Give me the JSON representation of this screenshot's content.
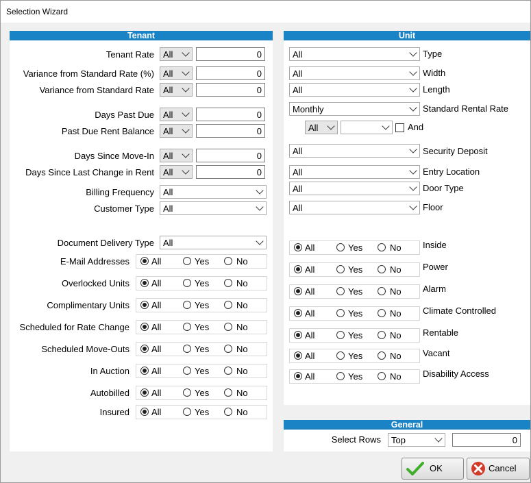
{
  "window": {
    "title": "Selection Wizard"
  },
  "tenant": {
    "header": "Tenant",
    "tenant_rate": {
      "label": "Tenant Rate",
      "op": "All",
      "value": "0"
    },
    "variance_pct": {
      "label": "Variance from Standard Rate (%)",
      "op": "All",
      "value": "0"
    },
    "variance_std": {
      "label": "Variance from Standard Rate",
      "op": "All",
      "value": "0"
    },
    "days_past_due": {
      "label": "Days Past Due",
      "op": "All",
      "value": "0"
    },
    "past_due_balance": {
      "label": "Past Due Rent Balance",
      "op": "All",
      "value": "0"
    },
    "days_since_move_in": {
      "label": "Days Since Move-In",
      "op": "All",
      "value": "0"
    },
    "days_since_change": {
      "label": "Days Since Last Change in Rent",
      "op": "All",
      "value": "0"
    },
    "billing_frequency": {
      "label": "Billing Frequency",
      "value": "All"
    },
    "customer_type": {
      "label": "Customer Type",
      "value": "All"
    },
    "document_delivery": {
      "label": "Document Delivery Type",
      "value": "All"
    },
    "radio_labels": {
      "all": "All",
      "yes": "Yes",
      "no": "No"
    },
    "radios": [
      {
        "label": "E-Mail Addresses",
        "selected": "All"
      },
      {
        "label": "Overlocked Units",
        "selected": "All"
      },
      {
        "label": "Complimentary Units",
        "selected": "All"
      },
      {
        "label": "Scheduled for Rate Change",
        "selected": "All"
      },
      {
        "label": "Scheduled Move-Outs",
        "selected": "All"
      },
      {
        "label": "In Auction",
        "selected": "All"
      },
      {
        "label": "Autobilled",
        "selected": "All"
      },
      {
        "label": "Insured",
        "selected": "All"
      }
    ]
  },
  "unit": {
    "header": "Unit",
    "type": {
      "label": "Type",
      "value": "All"
    },
    "width": {
      "label": "Width",
      "value": "All"
    },
    "length": {
      "label": "Length",
      "value": "All"
    },
    "standard_rental_rate": {
      "label": "Standard Rental Rate",
      "value": "Monthly"
    },
    "rate_op": {
      "value": "All"
    },
    "rate_value": {
      "value": ""
    },
    "and_label": "And",
    "and_checked": false,
    "security_deposit": {
      "label": "Security Deposit",
      "value": "All"
    },
    "entry_location": {
      "label": "Entry Location",
      "value": "All"
    },
    "door_type": {
      "label": "Door Type",
      "value": "All"
    },
    "floor": {
      "label": "Floor",
      "value": "All"
    },
    "radio_labels": {
      "all": "All",
      "yes": "Yes",
      "no": "No"
    },
    "radios": [
      {
        "label": "Inside",
        "selected": "All"
      },
      {
        "label": "Power",
        "selected": "All"
      },
      {
        "label": "Alarm",
        "selected": "All"
      },
      {
        "label": "Climate Controlled",
        "selected": "All"
      },
      {
        "label": "Rentable",
        "selected": "All"
      },
      {
        "label": "Vacant",
        "selected": "All"
      },
      {
        "label": "Disability Access",
        "selected": "All"
      }
    ]
  },
  "general": {
    "header": "General",
    "select_rows": {
      "label": "Select Rows",
      "mode": "Top",
      "value": "0"
    }
  },
  "buttons": {
    "ok": "OK",
    "cancel": "Cancel"
  },
  "colors": {
    "header_bg": "#1a83c6",
    "ok_icon": "#3fae2a",
    "cancel_icon": "#d23c2c"
  }
}
